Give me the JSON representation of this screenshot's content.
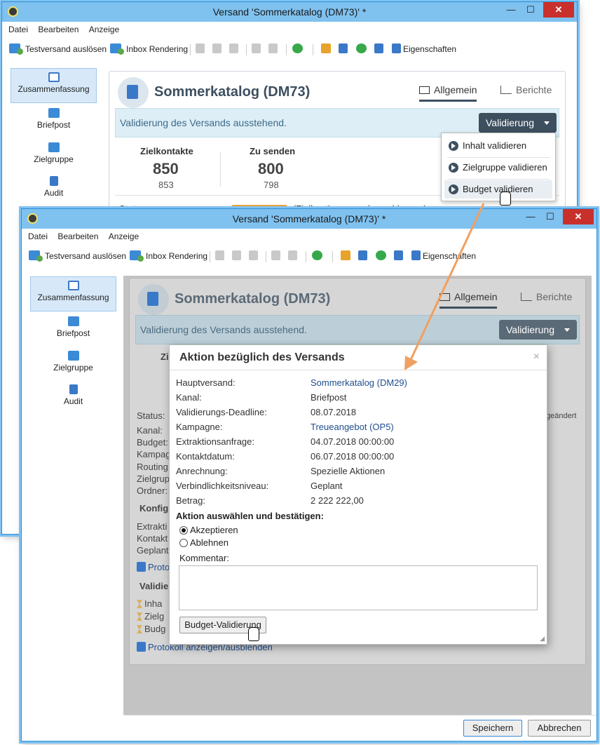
{
  "app": {
    "window_title": "Versand 'Sommerkatalog (DM73)' *",
    "menu": [
      "Datei",
      "Bearbeiten",
      "Anzeige"
    ],
    "toolbar": {
      "testversand": "Testversand auslösen",
      "inbox": "Inbox Rendering",
      "properties": "Eigenschaften"
    },
    "window_controls": {
      "minimize": "—",
      "maximize": "☐",
      "close": "✕"
    }
  },
  "nav": {
    "items": [
      {
        "label": "Zusammenfassung",
        "active": true,
        "icon": "window-icon"
      },
      {
        "label": "Briefpost",
        "active": false,
        "icon": "mail-icon"
      },
      {
        "label": "Zielgruppe",
        "active": false,
        "icon": "target-group-icon"
      },
      {
        "label": "Audit",
        "active": false,
        "icon": "audit-icon"
      }
    ]
  },
  "summary": {
    "title": "Sommerkatalog (DM73)",
    "tabs": {
      "general": "Allgemein",
      "reports": "Berichte"
    },
    "alert": "Validierung des Versands ausstehend.",
    "validate_button": "Validierung",
    "kpi": {
      "targets_label": "Zielkontakte",
      "targets_big": "850",
      "targets_small": "853",
      "tosend_label": "Zu senden",
      "tosend_big": "800",
      "tosend_small": "798"
    },
    "status_label": "Status:",
    "status_text": "(Zielbestimmung abgeschlossen)",
    "changed_text": "geändert"
  },
  "dropdown": {
    "items": [
      "Inhalt validieren",
      "Zielgruppe validieren",
      "Budget validieren"
    ]
  },
  "background_labels": {
    "status": "Status:",
    "kanal": "Kanal:",
    "budget": "Budget:",
    "kampagne": "Kampag",
    "routing": "Routing",
    "zielgruppe": "Zielgrup",
    "ordner": "Ordner:",
    "konfig": "Konfig",
    "extraktion": "Extrakti",
    "kontakt": "Kontakt",
    "geplant": "Geplant",
    "protokoll_short": "Proto",
    "validierung": "Validie",
    "inhalt": "Inha",
    "zielg": "Zielg",
    "budg": "Budg",
    "protokoll_full": "Protokoll anzeigen/ausblenden",
    "zi": "Zi"
  },
  "dialog": {
    "title": "Aktion bezüglich des Versands",
    "close": "×",
    "rows": [
      {
        "k": "Hauptversand:",
        "v": "Sommerkatalog (DM29)",
        "link": true
      },
      {
        "k": "Kanal:",
        "v": "Briefpost",
        "link": false
      },
      {
        "k": "Validierungs-Deadline:",
        "v": "08.07.2018",
        "link": false
      },
      {
        "k": "Kampagne:",
        "v": "Treueangebot (OP5)",
        "link": true
      },
      {
        "k": "Extraktionsanfrage:",
        "v": "04.07.2018 00:00:00",
        "link": false
      },
      {
        "k": "Kontaktdatum:",
        "v": "06.07.2018 00:00:00",
        "link": false
      },
      {
        "k": "Anrechnung:",
        "v": "Spezielle Aktionen",
        "link": false
      },
      {
        "k": "Verbindlichkeitsniveau:",
        "v": "Geplant",
        "link": false
      },
      {
        "k": "Betrag:",
        "v": "2 222 222,00",
        "link": false
      }
    ],
    "action_heading": "Aktion auswählen und bestätigen:",
    "accept": "Akzeptieren",
    "reject": "Ablehnen",
    "comment_label": "Kommentar:",
    "comment_value": "",
    "submit": "Budget-Validierung"
  },
  "footer": {
    "save": "Speichern",
    "cancel": "Abbrechen"
  },
  "colors": {
    "titlebar": "#7fc1ef",
    "accent_dark": "#3d4f5f",
    "link": "#1f4e8c",
    "arrow": "#f0a060"
  }
}
